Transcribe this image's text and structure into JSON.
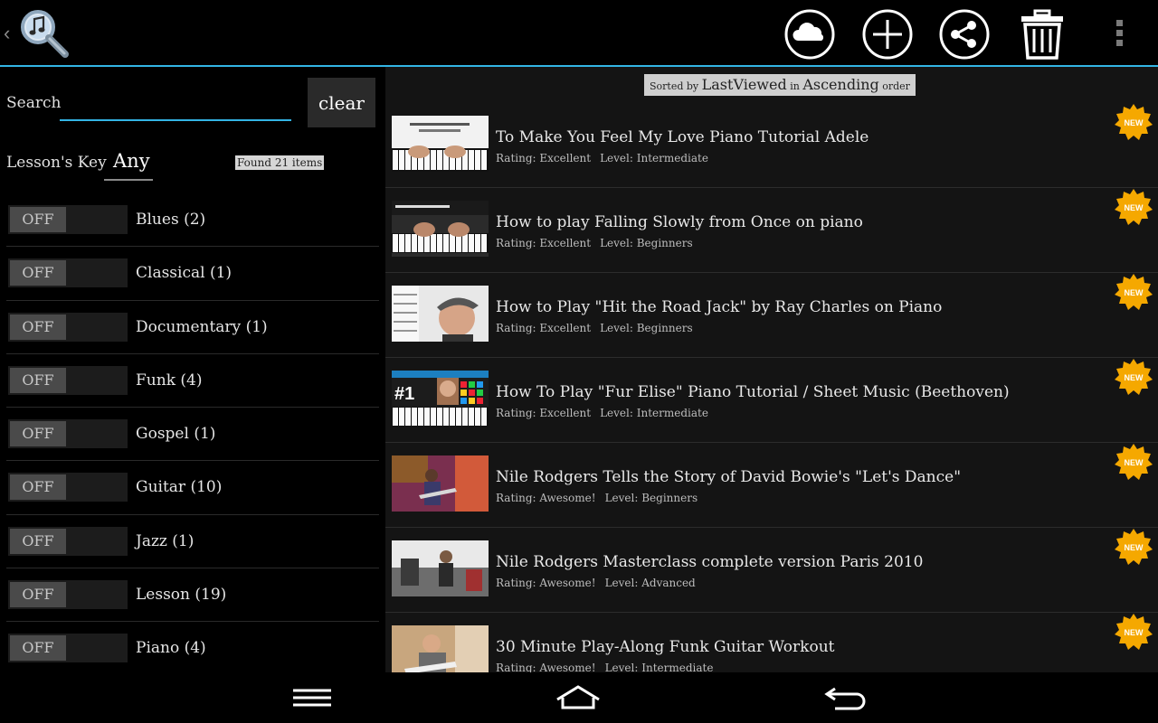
{
  "actionbar": {
    "icons": [
      "up-chevron-icon",
      "app-music-search-icon",
      "cloud-icon",
      "add-icon",
      "share-icon",
      "trash-icon",
      "overflow-menu-icon"
    ],
    "accent_color": "#33b5e5"
  },
  "left": {
    "search_label": "Search",
    "search_value": "",
    "clear_label": "clear",
    "key_label": "Lesson's Key",
    "key_value": "Any",
    "found_text": "Found 21 items",
    "genres": [
      {
        "toggle": "OFF",
        "name": "Blues (2)"
      },
      {
        "toggle": "OFF",
        "name": "Classical (1)"
      },
      {
        "toggle": "OFF",
        "name": "Documentary (1)"
      },
      {
        "toggle": "OFF",
        "name": "Funk (4)"
      },
      {
        "toggle": "OFF",
        "name": "Gospel (1)"
      },
      {
        "toggle": "OFF",
        "name": "Guitar (10)"
      },
      {
        "toggle": "OFF",
        "name": "Jazz (1)"
      },
      {
        "toggle": "OFF",
        "name": "Lesson (19)"
      },
      {
        "toggle": "OFF",
        "name": "Piano (4)"
      }
    ]
  },
  "right": {
    "sort": {
      "prefix": "Sorted by",
      "field": "LastViewed",
      "mid": "in",
      "direction": "Ascending",
      "suffix": "order"
    },
    "new_label": "NEW",
    "lessons": [
      {
        "title": "To Make You Feel My Love Piano Tutorial Adele",
        "rating": "Rating: Excellent",
        "level": "Level: Intermediate",
        "thumb": "piano-keys-thumbnail"
      },
      {
        "title": "How to play Falling Slowly from Once on piano",
        "rating": "Rating: Excellent",
        "level": "Level: Beginners",
        "thumb": "piano-keys-thumbnail"
      },
      {
        "title": "How to Play \"Hit the Road Jack\" by Ray Charles on Piano",
        "rating": "Rating: Excellent",
        "level": "Level: Beginners",
        "thumb": "man-with-cap-thumbnail"
      },
      {
        "title": "How To Play \"Fur Elise\" Piano Tutorial / Sheet Music (Beethoven)",
        "rating": "Rating: Excellent",
        "level": "Level: Intermediate",
        "thumb": "beethoven-piano-thumbnail"
      },
      {
        "title": "Nile Rodgers Tells the Story of David Bowie's \"Let's Dance\"",
        "rating": "Rating: Awesome!",
        "level": "Level: Beginners",
        "thumb": "guitarist-stage-thumbnail"
      },
      {
        "title": "Nile Rodgers Masterclass complete version Paris 2010",
        "rating": "Rating: Awesome!",
        "level": "Level: Advanced",
        "thumb": "studio-guitarist-thumbnail"
      },
      {
        "title": "30 Minute Play-Along Funk Guitar Workout",
        "rating": "Rating: Awesome!",
        "level": "Level: Intermediate",
        "thumb": "guitar-workout-thumbnail"
      }
    ]
  },
  "navbar": {
    "icons": [
      "menu-icon",
      "home-icon",
      "back-icon"
    ]
  }
}
